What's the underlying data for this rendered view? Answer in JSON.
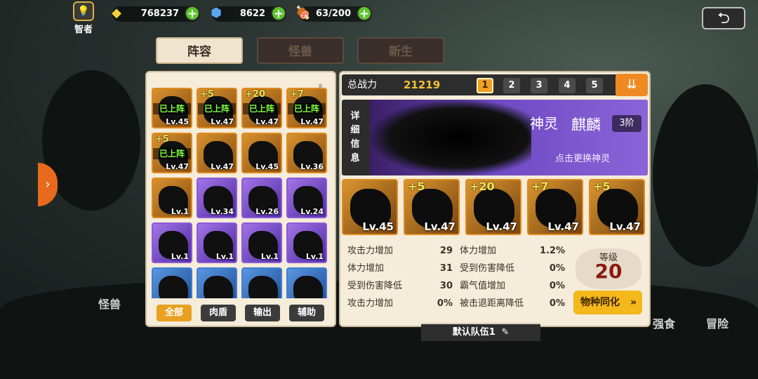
{
  "top": {
    "rank_label": "智者",
    "gold": "768237",
    "gems": "8622",
    "stamina": "63/200",
    "back_icon": "back-arrow-icon"
  },
  "tabs": [
    {
      "label": "阵容",
      "active": true
    },
    {
      "label": "怪兽",
      "active": false
    },
    {
      "label": "新生",
      "active": false
    }
  ],
  "roster": {
    "on_team_label": "已上阵",
    "cards": [
      {
        "lv": "Lv.45",
        "plus": "",
        "on_team": true,
        "color": "orange"
      },
      {
        "lv": "Lv.47",
        "plus": "+5",
        "on_team": true,
        "color": "orange"
      },
      {
        "lv": "Lv.47",
        "plus": "+20",
        "on_team": true,
        "color": "orange"
      },
      {
        "lv": "Lv.47",
        "plus": "+7",
        "on_team": true,
        "color": "orange"
      },
      {
        "lv": "Lv.47",
        "plus": "+5",
        "on_team": true,
        "color": "orange"
      },
      {
        "lv": "Lv.47",
        "plus": "",
        "on_team": false,
        "color": "orange"
      },
      {
        "lv": "Lv.45",
        "plus": "",
        "on_team": false,
        "color": "orange"
      },
      {
        "lv": "Lv.36",
        "plus": "",
        "on_team": false,
        "color": "orange"
      },
      {
        "lv": "Lv.1",
        "plus": "",
        "on_team": false,
        "color": "orange"
      },
      {
        "lv": "Lv.34",
        "plus": "",
        "on_team": false,
        "color": "purple"
      },
      {
        "lv": "Lv.26",
        "plus": "",
        "on_team": false,
        "color": "purple"
      },
      {
        "lv": "Lv.24",
        "plus": "",
        "on_team": false,
        "color": "purple"
      },
      {
        "lv": "Lv.1",
        "plus": "",
        "on_team": false,
        "color": "purple"
      },
      {
        "lv": "Lv.1",
        "plus": "",
        "on_team": false,
        "color": "purple"
      },
      {
        "lv": "Lv.1",
        "plus": "",
        "on_team": false,
        "color": "purple"
      },
      {
        "lv": "Lv.1",
        "plus": "",
        "on_team": false,
        "color": "purple"
      },
      {
        "lv": "",
        "plus": "",
        "on_team": false,
        "color": "blue"
      },
      {
        "lv": "",
        "plus": "",
        "on_team": false,
        "color": "blue"
      },
      {
        "lv": "",
        "plus": "",
        "on_team": false,
        "color": "blue"
      },
      {
        "lv": "",
        "plus": "",
        "on_team": false,
        "color": "blue"
      }
    ],
    "filters": [
      {
        "label": "全部",
        "active": true
      },
      {
        "label": "肉盾",
        "active": false
      },
      {
        "label": "输出",
        "active": false
      },
      {
        "label": "辅助",
        "active": false
      }
    ]
  },
  "power": {
    "label": "总战力",
    "value": "21219",
    "slots": [
      "1",
      "2",
      "3",
      "4",
      "5"
    ],
    "active_slot": "1"
  },
  "spirit": {
    "side_label": "详细信息",
    "class": "神灵",
    "name": "麒麟",
    "tier": "3阶",
    "hint": "点击更换神灵"
  },
  "team": [
    {
      "lv": "Lv.45",
      "plus": ""
    },
    {
      "lv": "Lv.47",
      "plus": "+5"
    },
    {
      "lv": "Lv.47",
      "plus": "+20"
    },
    {
      "lv": "Lv.47",
      "plus": "+7"
    },
    {
      "lv": "Lv.47",
      "plus": "+5"
    }
  ],
  "stats": [
    {
      "label": "攻击力增加",
      "value": "29"
    },
    {
      "label": "体力增加",
      "value": "1.2%"
    },
    {
      "label": "体力增加",
      "value": "31"
    },
    {
      "label": "受到伤害降低",
      "value": "0%"
    },
    {
      "label": "受到伤害降低",
      "value": "30"
    },
    {
      "label": "霸气值增加",
      "value": "0%"
    },
    {
      "label": "攻击力增加",
      "value": "0%"
    },
    {
      "label": "被击退距离降低",
      "value": "0%"
    }
  ],
  "level": {
    "label": "等级",
    "value": "20"
  },
  "sync_button": "物种同化",
  "team_name": "默认队伍1",
  "bottom_nav": [
    "怪兽",
    "强食",
    "冒险"
  ]
}
